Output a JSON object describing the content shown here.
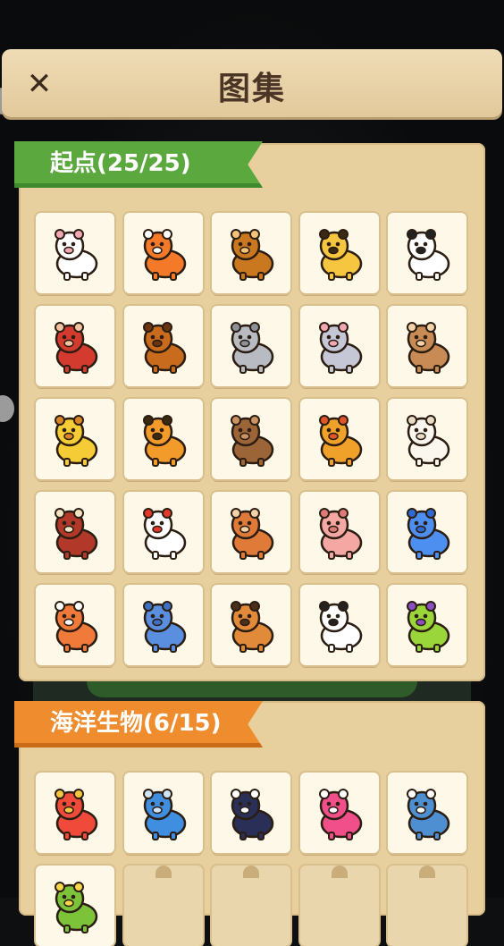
{
  "header": {
    "title": "图集",
    "close_label": "✕"
  },
  "sections": [
    {
      "label": "起点(25/25)",
      "animals": [
        {
          "icon": "rabbit-icon",
          "color": "#ffffff",
          "accent": "#f2a7b4"
        },
        {
          "icon": "fox-icon",
          "color": "#f47a2a",
          "accent": "#ffffff"
        },
        {
          "icon": "ox-icon",
          "color": "#c9781f",
          "accent": "#f3c37a"
        },
        {
          "icon": "leopard-icon",
          "color": "#f6c640",
          "accent": "#3a2a12"
        },
        {
          "icon": "panda-icon",
          "color": "#ffffff",
          "accent": "#222222"
        },
        {
          "icon": "gorilla-icon",
          "color": "#d43b2f",
          "accent": "#f2c3a0"
        },
        {
          "icon": "horse-icon",
          "color": "#c86b1c",
          "accent": "#6b3412"
        },
        {
          "icon": "elephant-icon",
          "color": "#b8bcc2",
          "accent": "#8c9097"
        },
        {
          "icon": "mouse-icon",
          "color": "#c6c7d6",
          "accent": "#f2a7b4"
        },
        {
          "icon": "monkey-icon",
          "color": "#c98b55",
          "accent": "#f3d2a8"
        },
        {
          "icon": "giraffe-icon",
          "color": "#f6cc36",
          "accent": "#d98726"
        },
        {
          "icon": "tiger-icon",
          "color": "#f29a2a",
          "accent": "#3a2a12"
        },
        {
          "icon": "bear-icon",
          "color": "#9b6538",
          "accent": "#c99462"
        },
        {
          "icon": "lion-icon",
          "color": "#f0a12a",
          "accent": "#e0542a"
        },
        {
          "icon": "sheep-icon",
          "color": "#fbf7ee",
          "accent": "#e8dcc7"
        },
        {
          "icon": "boar-icon",
          "color": "#b2392a",
          "accent": "#f3e3c5"
        },
        {
          "icon": "chicken-icon",
          "color": "#ffffff",
          "accent": "#e2392a"
        },
        {
          "icon": "hedgehog-icon",
          "color": "#e07a38",
          "accent": "#f3d2a8"
        },
        {
          "icon": "pig-icon",
          "color": "#f4a7a3",
          "accent": "#e07a78"
        },
        {
          "icon": "cat-icon",
          "color": "#4d8ff0",
          "accent": "#2f6ad0"
        },
        {
          "icon": "squirrel-icon",
          "color": "#f07a3a",
          "accent": "#ffffff"
        },
        {
          "icon": "rhino-icon",
          "color": "#5a8fe0",
          "accent": "#3e6fc0"
        },
        {
          "icon": "raccoon-icon",
          "color": "#e08a3a",
          "accent": "#4a2f1a"
        },
        {
          "icon": "cow-icon",
          "color": "#ffffff",
          "accent": "#222222"
        },
        {
          "icon": "parrot-icon",
          "color": "#9ad63a",
          "accent": "#8a4fc0"
        }
      ]
    },
    {
      "label": "海洋生物(6/15)",
      "animals": [
        {
          "icon": "fish-icon",
          "color": "#f04a3a",
          "accent": "#f6c640"
        },
        {
          "icon": "dolphin-icon",
          "color": "#3f8ee0",
          "accent": "#cfe4f7"
        },
        {
          "icon": "orca-icon",
          "color": "#2a2f57",
          "accent": "#ffffff"
        },
        {
          "icon": "octopus-icon",
          "color": "#f04f8a",
          "accent": "#ffffff"
        },
        {
          "icon": "shark-icon",
          "color": "#4d8fd0",
          "accent": "#ffffff"
        },
        {
          "icon": "seaweed-icon",
          "color": "#7cc33a",
          "accent": "#f6d64a"
        }
      ],
      "locked_count": 4
    }
  ],
  "colors": {
    "panel": "#e8cf9e",
    "ribbon_green": "#5aa83e",
    "ribbon_orange": "#ee8c2e"
  }
}
